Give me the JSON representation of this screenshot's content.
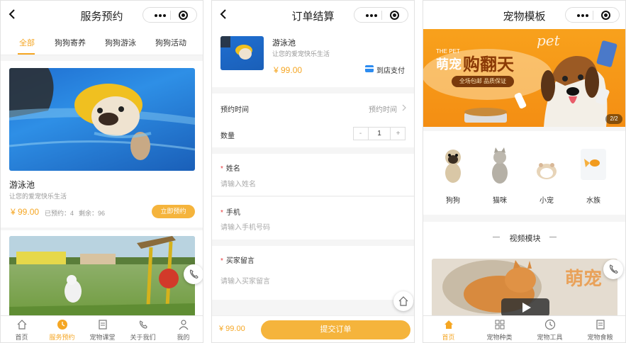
{
  "screen1": {
    "title": "服务预约",
    "tabs": [
      "全部",
      "狗狗寄养",
      "狗狗游泳",
      "狗狗活动"
    ],
    "item1": {
      "name": "游泳池",
      "desc": "让您的爱宠快乐生活",
      "price": "¥ 99.00",
      "booked": "已预约：4",
      "remain": "剩余：96",
      "button": "立即预约"
    },
    "tabbar": [
      "首页",
      "服务预约",
      "宠物课堂",
      "关于我们",
      "我的"
    ]
  },
  "screen2": {
    "title": "订单结算",
    "product": {
      "name": "游泳池",
      "desc": "让您的爱宠快乐生活",
      "price": "¥ 99.00",
      "pay": "到店支付"
    },
    "time_label": "预约时间",
    "time_value": "预约时间",
    "qty_label": "数量",
    "qty_minus": "-",
    "qty_value": "1",
    "qty_plus": "+",
    "name_label": "姓名",
    "name_placeholder": "请输入姓名",
    "phone_label": "手机",
    "phone_placeholder": "请输入手机号码",
    "msg_label": "买家留言",
    "msg_placeholder": "请输入买家留言",
    "total": "¥ 99.00",
    "submit": "提交订单"
  },
  "screen3": {
    "title": "宠物模板",
    "banner": {
      "en_small": "THE PET",
      "main_a": "萌宠",
      "main_b": "购翻天",
      "sub": "全场包邮 品质保证",
      "script": "pet",
      "page": "2/2"
    },
    "categories": [
      "狗狗",
      "猫咪",
      "小宠",
      "水族"
    ],
    "section": "视频模块",
    "video_text": "萌宠",
    "tabbar": [
      "首页",
      "宠物种类",
      "宠物工具",
      "宠物食粮"
    ]
  },
  "colors": {
    "accent": "#f5a623",
    "button": "#f5b43c",
    "required": "#e4393c"
  }
}
